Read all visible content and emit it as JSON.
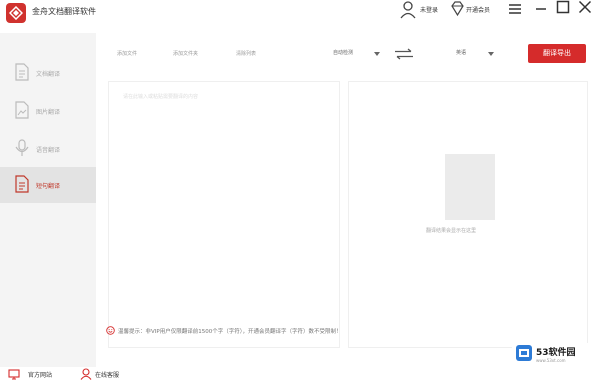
{
  "app": {
    "title": "金舟文档翻译软件",
    "login_label": "未登录",
    "vip_label": "开通会员"
  },
  "sidebar": {
    "items": [
      {
        "label": "文档翻译",
        "icon": "document-icon",
        "active": false
      },
      {
        "label": "图片翻译",
        "icon": "image-icon",
        "active": false
      },
      {
        "label": "语音翻译",
        "icon": "voice-icon",
        "active": false
      },
      {
        "label": "短句翻译",
        "icon": "text-icon",
        "active": true
      }
    ]
  },
  "toolbar": {
    "tabs": [
      "添加文件",
      "添加文件夹",
      "清除列表"
    ],
    "source_language": "自动检测",
    "target_language": "英语",
    "translate_button": "翻译导出"
  },
  "panels": {
    "left_hint": "请在此输入或粘贴需要翻译的内容",
    "right_placeholder": "翻译结果会显示在这里"
  },
  "notice": {
    "text": "温馨提示：非VIP用户仅限翻译前1500个字（字符），开通会员翻译字（字符）数不受限制！"
  },
  "bottom": {
    "website_label": "官方网站",
    "service_label": "在线客服"
  },
  "watermark": {
    "brand": "53软件园",
    "url": "www.53xt.com"
  },
  "colors": {
    "accent": "#d52b2b",
    "sidebar_bg": "#f4f4f4",
    "sidebar_active_bg": "#e3e3e3"
  }
}
